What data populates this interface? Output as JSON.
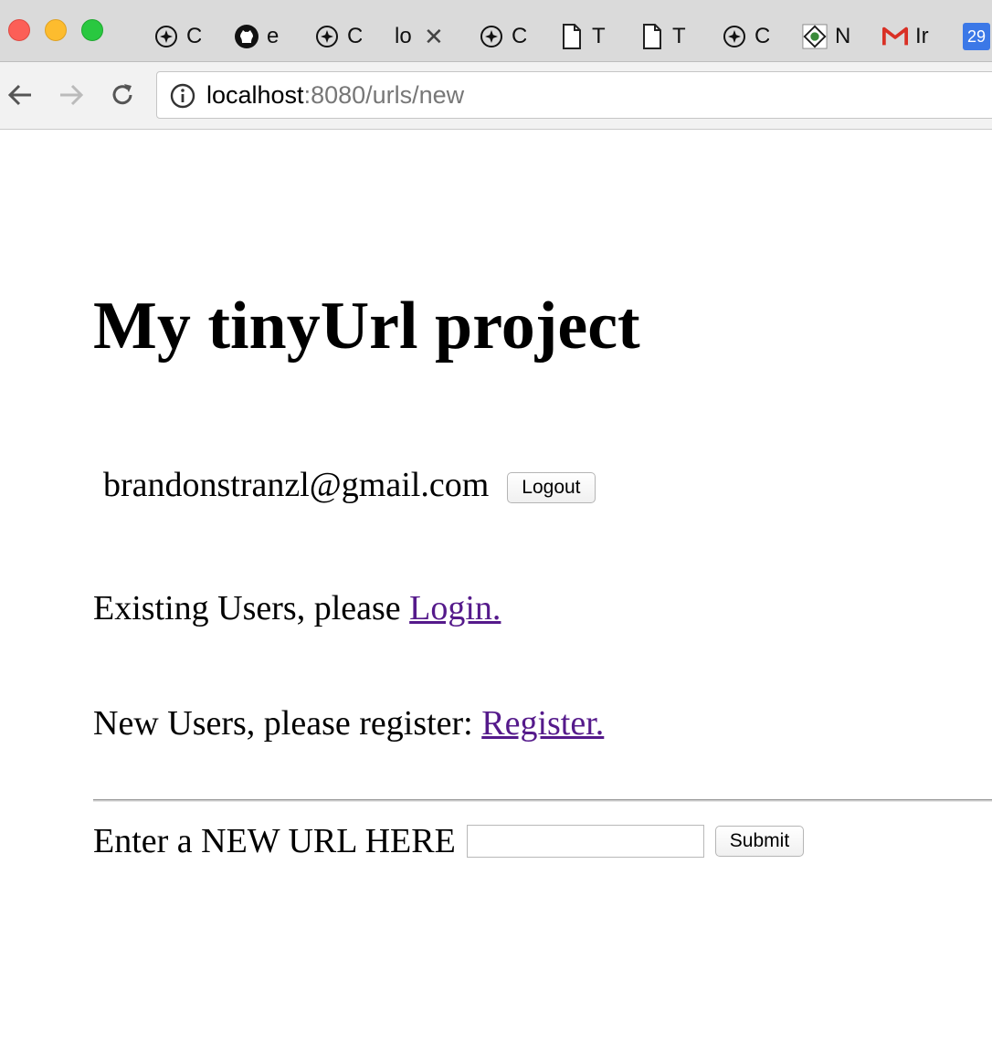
{
  "browser": {
    "tabs": [
      {
        "label": "C",
        "icon": "compass-icon"
      },
      {
        "label": "e",
        "icon": "github-icon"
      },
      {
        "label": "C",
        "icon": "compass-icon"
      },
      {
        "label": "lo",
        "icon": "",
        "active": true,
        "close": "✕"
      },
      {
        "label": "C",
        "icon": "compass-icon"
      },
      {
        "label": "T",
        "icon": "document-icon"
      },
      {
        "label": "T",
        "icon": "document-icon"
      },
      {
        "label": "C",
        "icon": "compass-icon"
      },
      {
        "label": "N",
        "icon": "site-logo-icon"
      },
      {
        "label": "Ir",
        "icon": "gmail-icon"
      },
      {
        "label": "",
        "icon": "calendar-icon",
        "badge": "29"
      }
    ],
    "address": {
      "host": "localhost",
      "rest": ":8080/urls/new"
    }
  },
  "page": {
    "title": "My tinyUrl project",
    "user_email": "brandonstranzl@gmail.com",
    "logout_label": "Logout",
    "existing_text": "Existing Users, please ",
    "login_link": "Login.",
    "new_text": "New Users, please register: ",
    "register_link": "Register.",
    "url_label": "Enter a NEW URL HERE",
    "url_value": "",
    "submit_label": "Submit"
  },
  "colors": {
    "link_visited": "#551a8b",
    "close_red": "#fc5f57",
    "minimize_yellow": "#fdbc2e",
    "zoom_green": "#29c840",
    "gmail_red": "#d93025",
    "calendar_blue": "#3b78e7"
  }
}
